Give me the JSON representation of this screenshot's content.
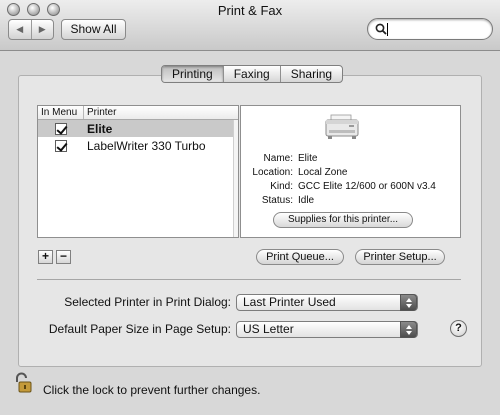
{
  "window": {
    "title": "Print & Fax"
  },
  "toolbar": {
    "back_glyph": "◀",
    "forward_glyph": "▶",
    "show_all_label": "Show All",
    "search_value": ""
  },
  "tabs": [
    {
      "label": "Printing",
      "selected": true
    },
    {
      "label": "Faxing",
      "selected": false
    },
    {
      "label": "Sharing",
      "selected": false
    }
  ],
  "printer_list": {
    "headers": {
      "in_menu": "In Menu",
      "printer": "Printer"
    },
    "rows": [
      {
        "name": "Elite",
        "in_menu": true,
        "selected": true
      },
      {
        "name": "LabelWriter 330 Turbo",
        "in_menu": true,
        "selected": false
      }
    ]
  },
  "details": {
    "name_label": "Name:",
    "name_value": "Elite",
    "location_label": "Location:",
    "location_value": "Local Zone",
    "kind_label": "Kind:",
    "kind_value": "GCC Elite 12/600 or 600N v3.4",
    "status_label": "Status:",
    "status_value": "Idle",
    "supplies_label": "Supplies for this printer..."
  },
  "buttons": {
    "add": "+",
    "remove": "−",
    "print_queue": "Print Queue...",
    "printer_setup": "Printer Setup..."
  },
  "settings": {
    "selected_printer_label": "Selected Printer in Print Dialog:",
    "selected_printer_value": "Last Printer Used",
    "paper_size_label": "Default Paper Size in Page Setup:",
    "paper_size_value": "US Letter"
  },
  "help_label": "?",
  "lock": {
    "text": "Click the lock to prevent further changes.",
    "icon": "lock-open-icon"
  }
}
